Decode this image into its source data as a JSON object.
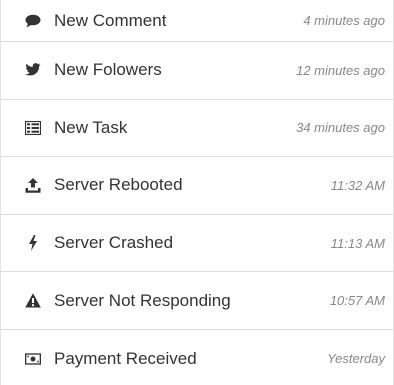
{
  "notifications": [
    {
      "icon": "comment-icon",
      "label": "New Comment",
      "time": "4 minutes ago"
    },
    {
      "icon": "twitter-icon",
      "label": "New Folowers",
      "time": "12 minutes ago"
    },
    {
      "icon": "tasks-icon",
      "label": "New Task",
      "time": "34 minutes ago"
    },
    {
      "icon": "upload-icon",
      "label": "Server Rebooted",
      "time": "11:32 AM"
    },
    {
      "icon": "bolt-icon",
      "label": "Server Crashed",
      "time": "11:13 AM"
    },
    {
      "icon": "warning-icon",
      "label": "Server Not Responding",
      "time": "10:57 AM"
    },
    {
      "icon": "money-icon",
      "label": "Payment Received",
      "time": "Yesterday"
    }
  ],
  "colors": {
    "text": "#333333",
    "time": "#888888",
    "divider": "#dedede"
  }
}
